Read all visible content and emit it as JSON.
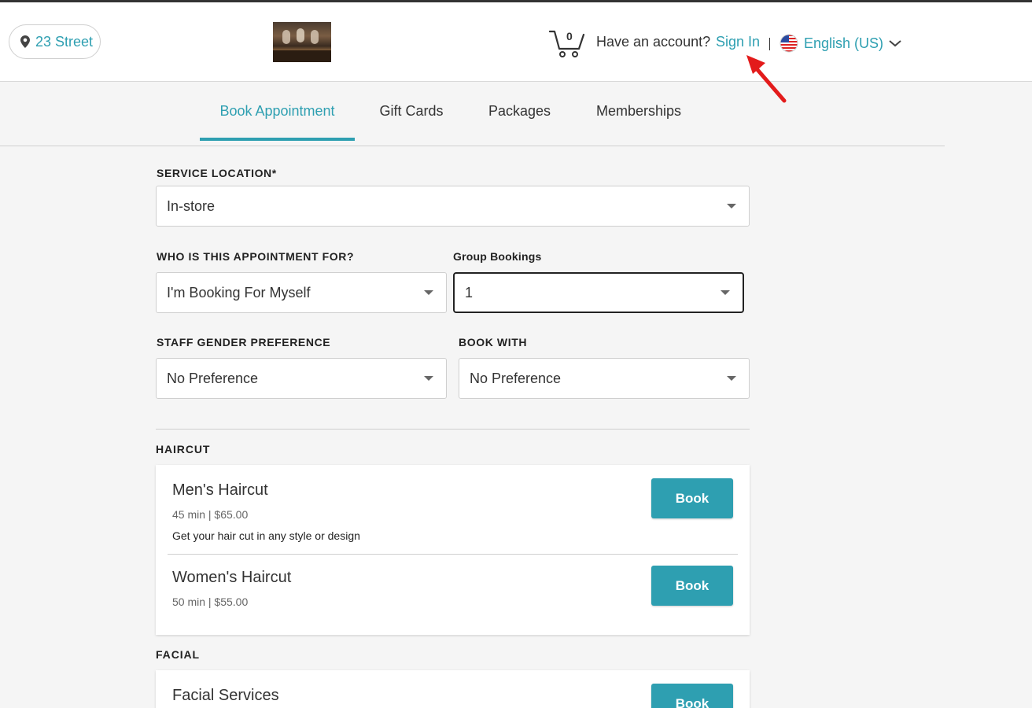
{
  "header": {
    "location": "23 Street",
    "cart_count": "0",
    "account_prompt": "Have an account?",
    "sign_in": "Sign In",
    "language": "English (US)"
  },
  "tabs": [
    {
      "label": "Book Appointment",
      "active": true
    },
    {
      "label": "Gift Cards"
    },
    {
      "label": "Packages"
    },
    {
      "label": "Memberships"
    }
  ],
  "form": {
    "service_location": {
      "label": "SERVICE LOCATION*",
      "value": "In-store"
    },
    "appointment_for": {
      "label": "WHO IS THIS APPOINTMENT FOR?",
      "value": "I'm Booking For Myself"
    },
    "group_bookings": {
      "label": "Group Bookings",
      "value": "1"
    },
    "staff_gender": {
      "label": "STAFF GENDER PREFERENCE",
      "value": "No Preference"
    },
    "book_with": {
      "label": "BOOK WITH",
      "value": "No Preference"
    }
  },
  "categories": [
    {
      "title": "HAIRCUT",
      "services": [
        {
          "name": "Men's Haircut",
          "meta": "45 min | $65.00",
          "description": "Get your hair cut in any style or design",
          "button": "Book"
        },
        {
          "name": "Women's Haircut",
          "meta": "50 min | $55.00",
          "button": "Book"
        }
      ]
    },
    {
      "title": "FACIAL",
      "services": [
        {
          "name": "Facial Services",
          "button": "Book"
        }
      ]
    }
  ],
  "colors": {
    "accent": "#2e9fb1",
    "annotation_arrow": "#e31b1b"
  }
}
